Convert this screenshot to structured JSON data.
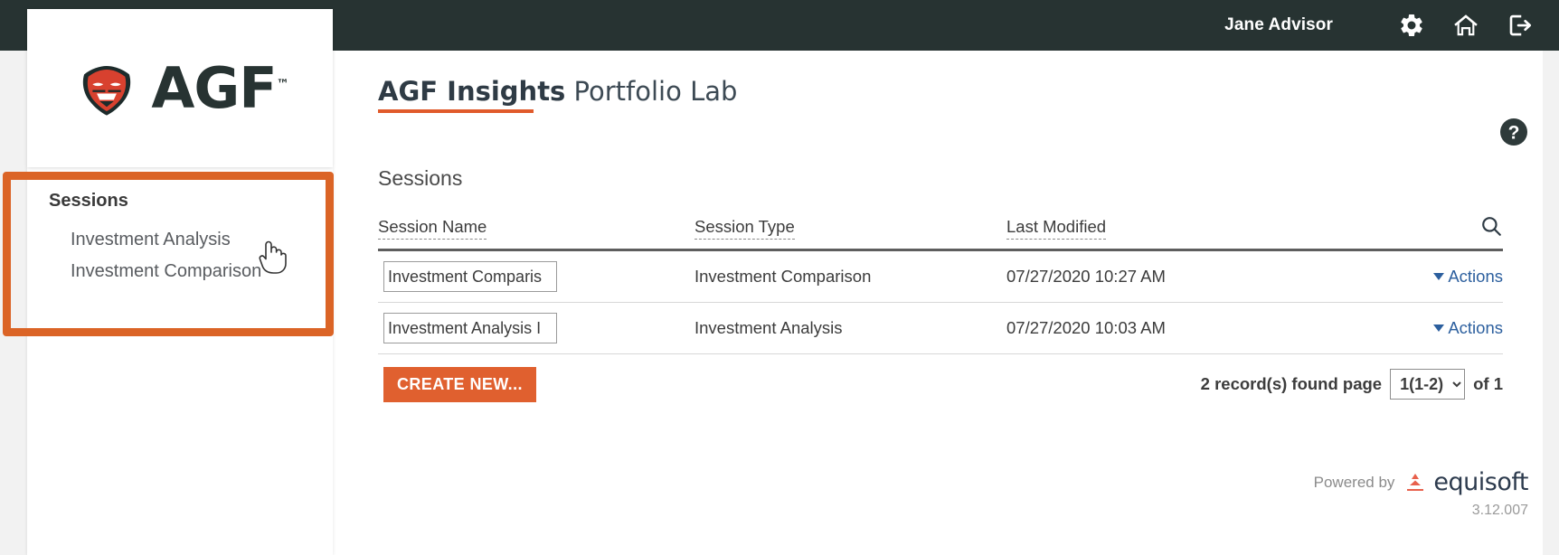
{
  "topbar": {
    "user_name": "Jane Advisor",
    "icons": [
      {
        "name": "gear-icon",
        "label": "Settings"
      },
      {
        "name": "home-icon",
        "label": "Home"
      },
      {
        "name": "logout-icon",
        "label": "Log out"
      }
    ],
    "background_color": "#273332"
  },
  "brand": {
    "logo_text": "AGF",
    "trademark": "™",
    "accent_color": "#e05a2b",
    "tiger_red": "#d8412f"
  },
  "sidebar": {
    "title": "Sessions",
    "items": [
      {
        "label": "Investment Analysis"
      },
      {
        "label": "Investment Comparison"
      }
    ]
  },
  "annotation": {
    "type": "highlight-box",
    "color": "#db6426"
  },
  "main": {
    "title_strong": "AGF Insights",
    "title_light": " Portfolio Lab",
    "help_icon_label": "?",
    "section_heading": "Sessions",
    "table": {
      "columns": [
        "Session Name",
        "Session Type",
        "Last Modified"
      ],
      "search_icon": "search-icon",
      "rows": [
        {
          "name_value": "Investment Comparis",
          "type": "Investment Comparison",
          "last_modified": "07/27/2020 10:27 AM",
          "actions_label": "Actions"
        },
        {
          "name_value": "Investment Analysis I",
          "type": "Investment Analysis",
          "last_modified": "07/27/2020 10:03 AM",
          "actions_label": "Actions"
        }
      ]
    },
    "create_button": "CREATE NEW...",
    "pager": {
      "records_label": "2 record(s) found page",
      "selected_page": "1(1-2)",
      "options": [
        "1(1-2)"
      ],
      "of_label": "of 1"
    }
  },
  "footer": {
    "powered_by": "Powered by",
    "vendor": "equisoft",
    "version": "3.12.007"
  }
}
